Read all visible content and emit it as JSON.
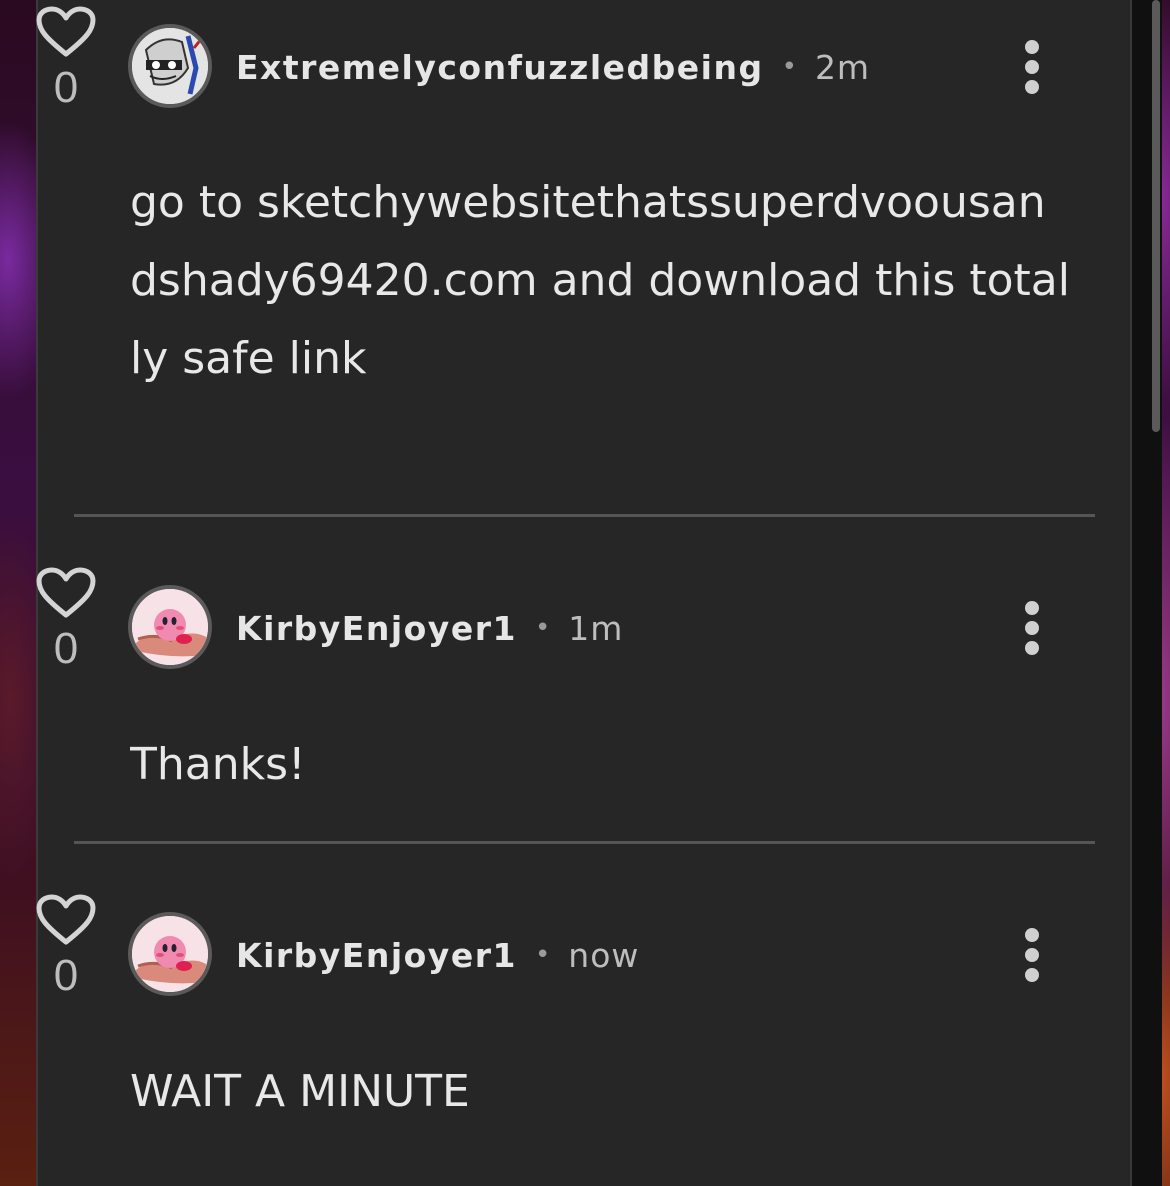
{
  "comments": [
    {
      "likes": "0",
      "username": "Extremelyconfuzzledbeing",
      "separator": "•",
      "time": "2m",
      "body": "go to sketchywebsitethatssuperdvoousandshady69420.com and download this totally safe link",
      "avatar": "avatar-sketch"
    },
    {
      "likes": "0",
      "username": "KirbyEnjoyer1",
      "separator": "•",
      "time": "1m",
      "body": "Thanks!",
      "avatar": "avatar-kirby"
    },
    {
      "likes": "0",
      "username": "KirbyEnjoyer1",
      "separator": "•",
      "time": "now",
      "body": "WAIT A MINUTE",
      "avatar": "avatar-kirby"
    }
  ],
  "icons": {
    "like": "heart-icon",
    "menu": "more-vertical-icon"
  },
  "colors": {
    "panel": "#262626",
    "text": "#e8e8e8",
    "muted": "#bdbdbd",
    "divider": "#555555"
  }
}
